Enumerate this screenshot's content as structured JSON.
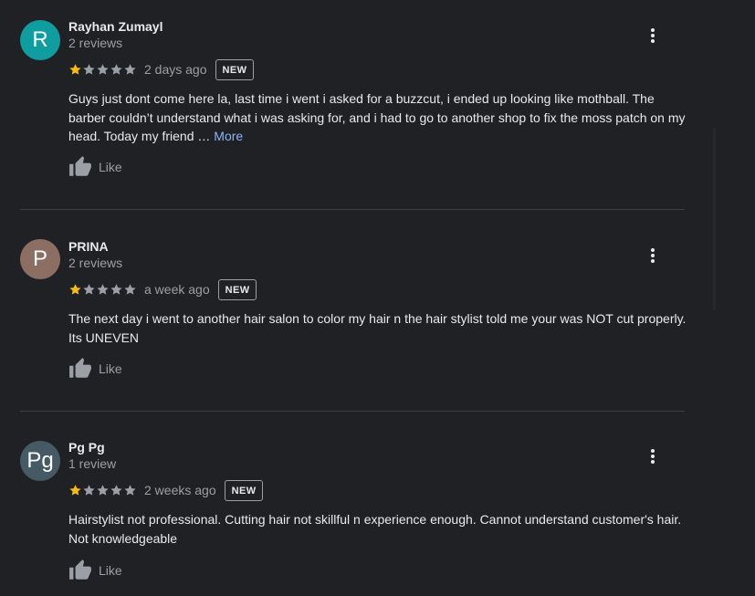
{
  "colors": {
    "background": "#202124",
    "star_filled": "#fbbc04",
    "star_empty": "#9aa0a6",
    "link": "#8ab4f8",
    "divider": "#3c4043"
  },
  "icons": {
    "star": "star-icon",
    "like": "thumb-up-icon",
    "menu": "more-vert-icon"
  },
  "like_label": "Like",
  "reviews": [
    {
      "initial": "R",
      "avatar_color": "#0f9d9f",
      "name": "Rayhan Zumayl",
      "review_count": "2 reviews",
      "rating": 1,
      "date": "2 days ago",
      "badge": "NEW",
      "text": "Guys just dont come here la, last time i went i asked for a buzzcut, i ended up looking like mothball. The barber couldn’t understand what i was asking for, and i had to go to another shop to fix the moss patch on my head. Today my friend …",
      "more_label": "More"
    },
    {
      "initial": "P",
      "avatar_color": "#8d6e63",
      "name": "PRINA",
      "review_count": "2 reviews",
      "rating": 1,
      "date": "a week ago",
      "badge": "NEW",
      "text": "The next day i went to another hair salon to color my hair n the hair stylist told me your was NOT cut properly. Its UNEVEN"
    },
    {
      "initial": "Pg",
      "avatar_color": "#455a64",
      "name": "Pg Pg",
      "review_count": "1 review",
      "rating": 1,
      "date": "2 weeks ago",
      "badge": "NEW",
      "text": "Hairstylist not professional. Cutting hair not skillful n experience enough. Cannot understand customer's hair. Not knowledgeable"
    }
  ]
}
